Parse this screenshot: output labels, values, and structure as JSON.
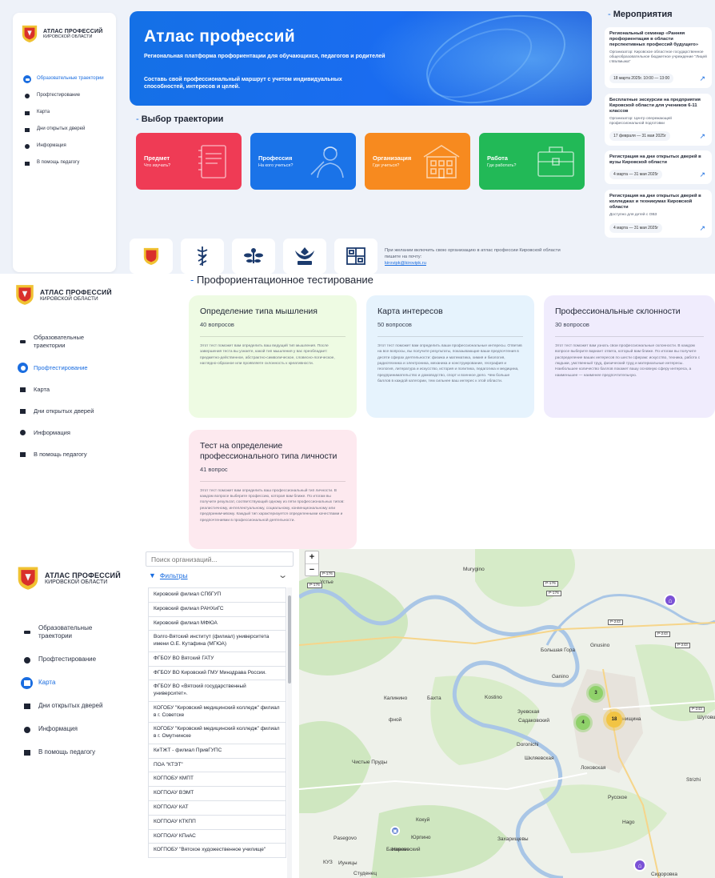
{
  "brand": {
    "line1": "АТЛАС ПРОФЕССИЙ",
    "line2": "КИРОВСКОЙ ОБЛАСТИ"
  },
  "nav": [
    {
      "label": "Образовательные траектории",
      "icon": "trajectory-icon"
    },
    {
      "label": "Профтестирование",
      "icon": "test-icon"
    },
    {
      "label": "Карта",
      "icon": "map-icon"
    },
    {
      "label": "Дни открытых дверей",
      "icon": "door-icon"
    },
    {
      "label": "Информация",
      "icon": "info-icon"
    },
    {
      "label": "В помощь педагогу",
      "icon": "teacher-icon"
    }
  ],
  "hero": {
    "title": "Атлас профессий",
    "subtitle": "Региональная платформа профориентации для обучающихся, педагогов и родителей",
    "cta": "Составь свой профессиональный маршрут с учетом индивидуальных способностей, интересов и целей."
  },
  "trajectory": {
    "title": "Выбор траектории",
    "tiles": [
      {
        "title": "Предмет",
        "question": "Что изучать?",
        "color": "#ef3b55"
      },
      {
        "title": "Профессия",
        "question": "На кого учиться?",
        "color": "#1a73e8"
      },
      {
        "title": "Организация",
        "question": "Где учиться?",
        "color": "#f78a1f"
      },
      {
        "title": "Работа",
        "question": "Где работать?",
        "color": "#22b957"
      }
    ]
  },
  "partners": {
    "note": "При желании включить свою организацию в атлас профессии Кировской области пишите на почту:",
    "email": "kirovipk@kirovipk.ru"
  },
  "events": {
    "title": "Мероприятия",
    "items": [
      {
        "title": "Региональный семинар «Ранняя профориентация в области перспективных профессий будущего»",
        "org": "Организатор: Кировское областное государственное общеобразовательное бюджетное учреждение \"Лицей г.Малмыжа\"",
        "date": "18 марта 2025г. 10:00 — 13:00"
      },
      {
        "title": "Бесплатные экскурсии на предприятия Кировской области для учеников 6-11 классов",
        "org": "Организатор: Центр опережающей профессиональной подготовки",
        "date": "17 февраля — 31 мая 2025г"
      },
      {
        "title": "Регистрация на дни открытых дверей в вузы Кировской области",
        "org": "",
        "date": "4 марта — 31 мая 2025г"
      },
      {
        "title": "Регистрация на дни открытых дверей в колледжах и техникумах Кировской области",
        "org": "Доступно для детей с ОВЗ",
        "date": "4 марта — 31 мая 2025г"
      }
    ]
  },
  "tests": {
    "title": "Профориентационное тестирование",
    "items": [
      {
        "title": "Определение типа мышления",
        "count": "40 вопросов",
        "desc": "Этот тест поможет вам определить ваш ведущий тип мышления. После завершения теста вы узнаете, какой тип мышления у вас преобладает: предметно-действенное, абстрактно-символическое, словесно-логическое, наглядно-образное или проявляете склонность к креативности."
      },
      {
        "title": "Карта интересов",
        "count": "50 вопросов",
        "desc": "Этот тест поможет вам определить ваши профессиональные интересы. Ответив на все вопросы, вы получите результаты, показывающие ваши предпочтения в десяти сферах деятельности: физика и математика, химия и биология, радиотехника и электроника, механика и конструирование, география и геология, литература и искусство, история и политика, педагогика и медицина, предпринимательство и домоводство, спорт и военное дело. Чем больше баллов в каждой категории, тем сильнее ваш интерес к этой области."
      },
      {
        "title": "Профессиональные склонности",
        "count": "30 вопросов",
        "desc": "Этот тест поможет вам узнать свои профессиональные склонности. В каждом вопросе выберите вариант ответа, который вам ближе. По итогам вы получите распределение ваших интересов по шести сферам: искусство, техника, работа с людьми, умственный труд, физический труд и материальные интересы. Наибольшее количество баллов покажет вашу основную сферу интереса, а наименьшее — наименее предпочтительную."
      },
      {
        "title": "Тест на определение профессионального типа личности",
        "count": "41 вопрос",
        "desc": "Этот тест поможет вам определить ваш профессиональный тип личности. В каждом вопросе выберите профессию, которая вам ближе. По итогам вы получите результат, соответствующий одному из пяти профессиональных типов: реалистичному, интеллектуальному, социальному, конвенциональному или предпринимчивому. Каждый тип характеризуется определенными качествами и предпочтениями в профессиональной деятельности."
      }
    ]
  },
  "map_page": {
    "search_placeholder": "Поиск организаций...",
    "filters_label": "Фильтры",
    "orgs": [
      "Кировский филиал СПбГУП",
      "Кировский филиал РАНХиГС",
      "Кировский филиал МФЮА",
      "Волго-Вятский институт (филиал) университета имени О.Е. Кутафина (МГЮА)",
      "ФГБОУ ВО Вятский ГАТУ",
      "ФГБОУ ВО Кировский ГМУ Минздрава России.",
      "ФГБОУ ВО «Вятский государственный университет».",
      "КОГОБУ \"Кировский медицинский колледж\" филиал в г. Советске",
      "КОГОБУ \"Кировский медицинский колледж\" филиал в г. Омутнинске",
      "КиТЖТ - филиал ПривГУПС",
      "ПОА \"КТЭТ\"",
      "КОГПОБУ КМПТ",
      "КОГПОАУ ВЭМТ",
      "КОГПОАУ КАТ",
      "КОГПОАУ КТКПП",
      "КОГПОАУ КПиАС",
      "КОГПОБУ \"Вятское художественное училище\""
    ],
    "zoom_in": "+",
    "zoom_out": "−",
    "places": [
      "Murygino",
      "Устье",
      "Бахта",
      "Gnusino",
      "Большая Гора",
      "Ganino",
      "Kostino",
      "Калинино",
      "Зуевская",
      "Садаковский",
      "Doronichi",
      "Шкляевская",
      "Лоховская",
      "Чистые Пруды",
      "Русское",
      "Кокуй",
      "Юрпино",
      "Захарищевы",
      "Pasegovo",
      "Бахарево",
      "Иуницы",
      "Студенец",
      "Strizhi",
      "Сидоровка",
      "Шутовщина",
      "Hago",
      "Новоvеский",
      "КУЗ",
      "фной",
      "Балезнищина",
      "K"
    ],
    "roads": [
      "Р-176",
      "Р-176",
      "Р-176",
      "Р-176",
      "Р-243",
      "Р-243",
      "Р-243",
      "Р-243"
    ],
    "clusters": [
      "3",
      "4",
      "18"
    ]
  }
}
